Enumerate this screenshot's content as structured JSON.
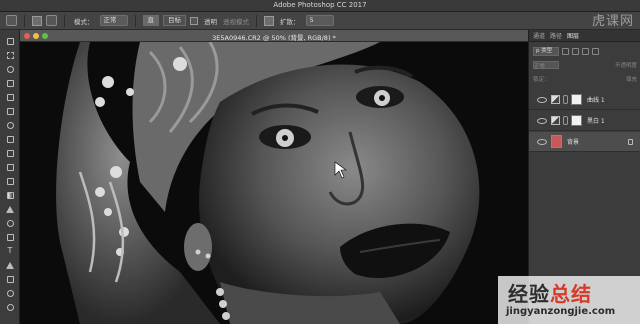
{
  "window": {
    "title": "Adobe Photoshop CC 2017"
  },
  "options_bar": {
    "mode_label": "模式：",
    "mode_value": "正常",
    "btn_1": "直",
    "btn_2": "目标",
    "checkbox_label": "透明",
    "dim_label": "透视模式",
    "zoom_label": "扩散：",
    "zoom_value": "5"
  },
  "document": {
    "tab_title": "3E5A0946.CR2 @ 50% (背景, RGB/8) *"
  },
  "right_panel": {
    "tabs": [
      "通道",
      "路径",
      "图层"
    ],
    "filter_label": "p 类型",
    "mode_label": "正常",
    "opacity_label": "不透明度",
    "lock_label": "锁定：",
    "fill_label": "填充",
    "layers": [
      {
        "name": "曲线 1",
        "kind": "adjustment"
      },
      {
        "name": "黑白 1",
        "kind": "adjustment"
      },
      {
        "name": "背景",
        "kind": "image"
      }
    ]
  },
  "watermark": {
    "top_text": "虎课网",
    "big_part1": "经验",
    "big_part2": "总结",
    "url": "jingyanzongjie.com"
  },
  "colors": {
    "traffic_red": "#ee5b52",
    "traffic_yellow": "#f3bd44",
    "traffic_green": "#5cc149"
  }
}
